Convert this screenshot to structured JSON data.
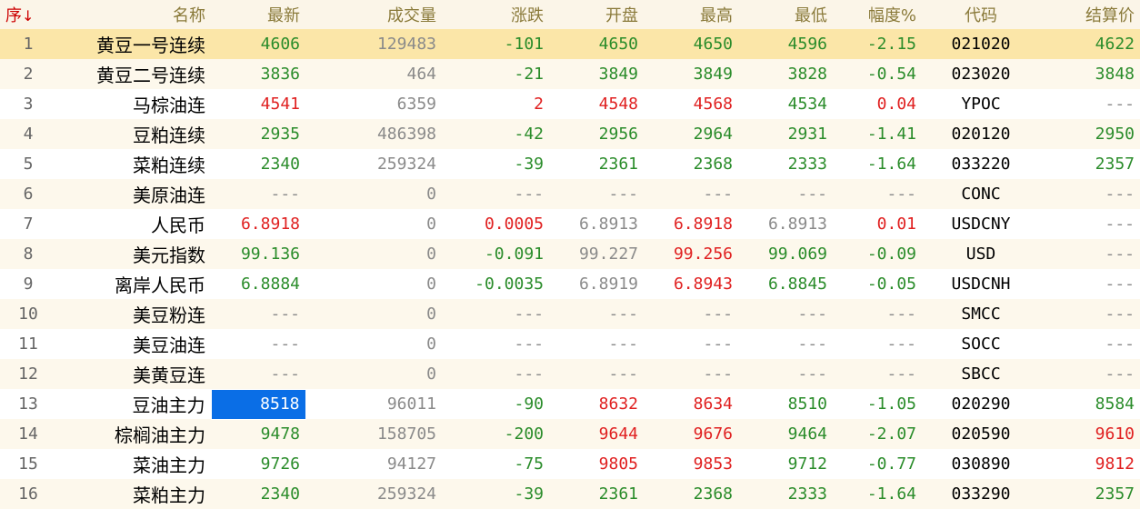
{
  "header": {
    "idx": "序",
    "sort_arrow": "↓",
    "name": "名称",
    "last": "最新",
    "volume": "成交量",
    "change": "涨跌",
    "open": "开盘",
    "high": "最高",
    "low": "最低",
    "pct": "幅度%",
    "code": "代码",
    "settle": "结算价"
  },
  "colors": {
    "up": "#e02020",
    "down": "#2a8c2a",
    "neutral": "#8a8a8a",
    "selected_row": "#fbe6a8",
    "focus_cell": "#0a6ee6"
  },
  "rows": [
    {
      "idx": "1",
      "name": "黄豆一号连续",
      "last": "4606",
      "volume": "129483",
      "change": "-101",
      "open": "4650",
      "high": "4650",
      "low": "4596",
      "pct": "-2.15",
      "code": "021020",
      "settle": "4622"
    },
    {
      "idx": "2",
      "name": "黄豆二号连续",
      "last": "3836",
      "volume": "464",
      "change": "-21",
      "open": "3849",
      "high": "3849",
      "low": "3828",
      "pct": "-0.54",
      "code": "023020",
      "settle": "3848"
    },
    {
      "idx": "3",
      "name": "马棕油连",
      "last": "4541",
      "volume": "6359",
      "change": "2",
      "open": "4548",
      "high": "4568",
      "low": "4534",
      "pct": "0.04",
      "code": "YPOC",
      "settle": "---"
    },
    {
      "idx": "4",
      "name": "豆粕连续",
      "last": "2935",
      "volume": "486398",
      "change": "-42",
      "open": "2956",
      "high": "2964",
      "low": "2931",
      "pct": "-1.41",
      "code": "020120",
      "settle": "2950"
    },
    {
      "idx": "5",
      "name": "菜粕连续",
      "last": "2340",
      "volume": "259324",
      "change": "-39",
      "open": "2361",
      "high": "2368",
      "low": "2333",
      "pct": "-1.64",
      "code": "033220",
      "settle": "2357"
    },
    {
      "idx": "6",
      "name": "美原油连",
      "last": "---",
      "volume": "0",
      "change": "---",
      "open": "---",
      "high": "---",
      "low": "---",
      "pct": "---",
      "code": "CONC",
      "settle": "---"
    },
    {
      "idx": "7",
      "name": "人民币",
      "last": "6.8918",
      "volume": "0",
      "change": "0.0005",
      "open": "6.8913",
      "high": "6.8918",
      "low": "6.8913",
      "pct": "0.01",
      "code": "USDCNY",
      "settle": "---"
    },
    {
      "idx": "8",
      "name": "美元指数",
      "last": "99.136",
      "volume": "0",
      "change": "-0.091",
      "open": "99.227",
      "high": "99.256",
      "low": "99.069",
      "pct": "-0.09",
      "code": "USD",
      "settle": "---"
    },
    {
      "idx": "9",
      "name": "离岸人民币",
      "last": "6.8884",
      "volume": "0",
      "change": "-0.0035",
      "open": "6.8919",
      "high": "6.8943",
      "low": "6.8845",
      "pct": "-0.05",
      "code": "USDCNH",
      "settle": "---"
    },
    {
      "idx": "10",
      "name": "美豆粉连",
      "last": "---",
      "volume": "0",
      "change": "---",
      "open": "---",
      "high": "---",
      "low": "---",
      "pct": "---",
      "code": "SMCC",
      "settle": "---"
    },
    {
      "idx": "11",
      "name": "美豆油连",
      "last": "---",
      "volume": "0",
      "change": "---",
      "open": "---",
      "high": "---",
      "low": "---",
      "pct": "---",
      "code": "SOCC",
      "settle": "---"
    },
    {
      "idx": "12",
      "name": "美黄豆连",
      "last": "---",
      "volume": "0",
      "change": "---",
      "open": "---",
      "high": "---",
      "low": "---",
      "pct": "---",
      "code": "SBCC",
      "settle": "---"
    },
    {
      "idx": "13",
      "name": "豆油主力",
      "last": "8518",
      "volume": "96011",
      "change": "-90",
      "open": "8632",
      "high": "8634",
      "low": "8510",
      "pct": "-1.05",
      "code": "020290",
      "settle": "8584"
    },
    {
      "idx": "14",
      "name": "棕榈油主力",
      "last": "9478",
      "volume": "158705",
      "change": "-200",
      "open": "9644",
      "high": "9676",
      "low": "9464",
      "pct": "-2.07",
      "code": "020590",
      "settle": "9610"
    },
    {
      "idx": "15",
      "name": "菜油主力",
      "last": "9726",
      "volume": "94127",
      "change": "-75",
      "open": "9805",
      "high": "9853",
      "low": "9712",
      "pct": "-0.77",
      "code": "030890",
      "settle": "9812"
    },
    {
      "idx": "16",
      "name": "菜粕主力",
      "last": "2340",
      "volume": "259324",
      "change": "-39",
      "open": "2361",
      "high": "2368",
      "low": "2333",
      "pct": "-1.64",
      "code": "033290",
      "settle": "2357"
    }
  ],
  "cell_colors": [
    {
      "last": "g",
      "change": "g",
      "open": "g",
      "high": "g",
      "low": "g",
      "pct": "g",
      "settle": "g"
    },
    {
      "last": "g",
      "change": "g",
      "open": "g",
      "high": "g",
      "low": "g",
      "pct": "g",
      "settle": "g"
    },
    {
      "last": "r",
      "change": "r",
      "open": "r",
      "high": "r",
      "low": "g",
      "pct": "r",
      "settle": "gy"
    },
    {
      "last": "g",
      "change": "g",
      "open": "g",
      "high": "g",
      "low": "g",
      "pct": "g",
      "settle": "g"
    },
    {
      "last": "g",
      "change": "g",
      "open": "g",
      "high": "g",
      "low": "g",
      "pct": "g",
      "settle": "g"
    },
    {
      "last": "gy",
      "change": "gy",
      "open": "gy",
      "high": "gy",
      "low": "gy",
      "pct": "gy",
      "settle": "gy"
    },
    {
      "last": "r",
      "change": "r",
      "open": "gy",
      "high": "r",
      "low": "gy",
      "pct": "r",
      "settle": "gy"
    },
    {
      "last": "g",
      "change": "g",
      "open": "gy",
      "high": "r",
      "low": "g",
      "pct": "g",
      "settle": "gy"
    },
    {
      "last": "g",
      "change": "g",
      "open": "gy",
      "high": "r",
      "low": "g",
      "pct": "g",
      "settle": "gy"
    },
    {
      "last": "gy",
      "change": "gy",
      "open": "gy",
      "high": "gy",
      "low": "gy",
      "pct": "gy",
      "settle": "gy"
    },
    {
      "last": "gy",
      "change": "gy",
      "open": "gy",
      "high": "gy",
      "low": "gy",
      "pct": "gy",
      "settle": "gy"
    },
    {
      "last": "gy",
      "change": "gy",
      "open": "gy",
      "high": "gy",
      "low": "gy",
      "pct": "gy",
      "settle": "gy"
    },
    {
      "last": "g",
      "change": "g",
      "open": "r",
      "high": "r",
      "low": "g",
      "pct": "g",
      "settle": "g"
    },
    {
      "last": "g",
      "change": "g",
      "open": "r",
      "high": "r",
      "low": "g",
      "pct": "g",
      "settle": "r"
    },
    {
      "last": "g",
      "change": "g",
      "open": "r",
      "high": "r",
      "low": "g",
      "pct": "g",
      "settle": "r"
    },
    {
      "last": "g",
      "change": "g",
      "open": "g",
      "high": "g",
      "low": "g",
      "pct": "g",
      "settle": "g"
    }
  ],
  "selected_row": 1,
  "focused_cell": {
    "row": 13,
    "col": "last"
  }
}
